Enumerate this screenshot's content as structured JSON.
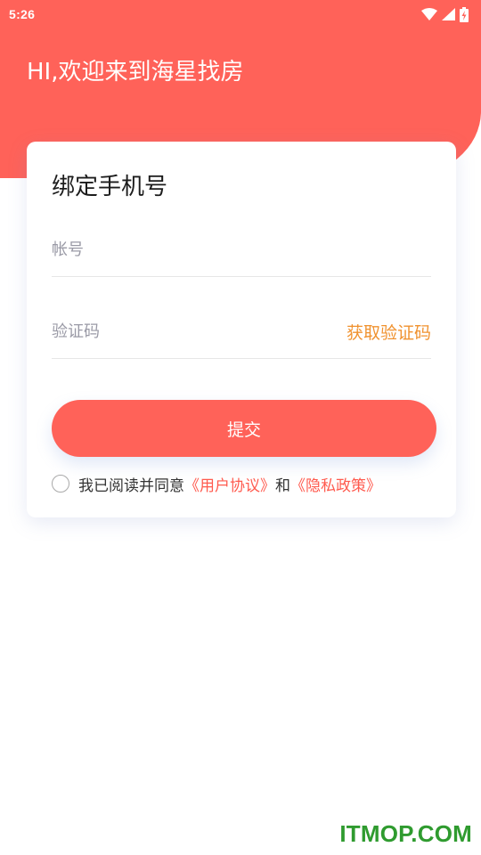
{
  "status_bar": {
    "time": "5:26",
    "icons": [
      "wifi-icon",
      "signal-icon",
      "battery-charging-icon"
    ]
  },
  "header": {
    "welcome": "HI,欢迎来到海星找房"
  },
  "form": {
    "title": "绑定手机号",
    "account_placeholder": "帐号",
    "account_value": "",
    "code_placeholder": "验证码",
    "code_value": "",
    "get_code_label": "获取验证码",
    "submit_label": "提交"
  },
  "agreement": {
    "checked": false,
    "prefix": "我已阅读并同意",
    "user_agreement": "《用户协议》",
    "and": "和",
    "privacy_policy": "《隐私政策》"
  },
  "colors": {
    "brand": "#ff6259",
    "accent_orange": "#f0922f",
    "link_red": "#ff5a4e"
  },
  "watermark": "ITMOP.COM"
}
